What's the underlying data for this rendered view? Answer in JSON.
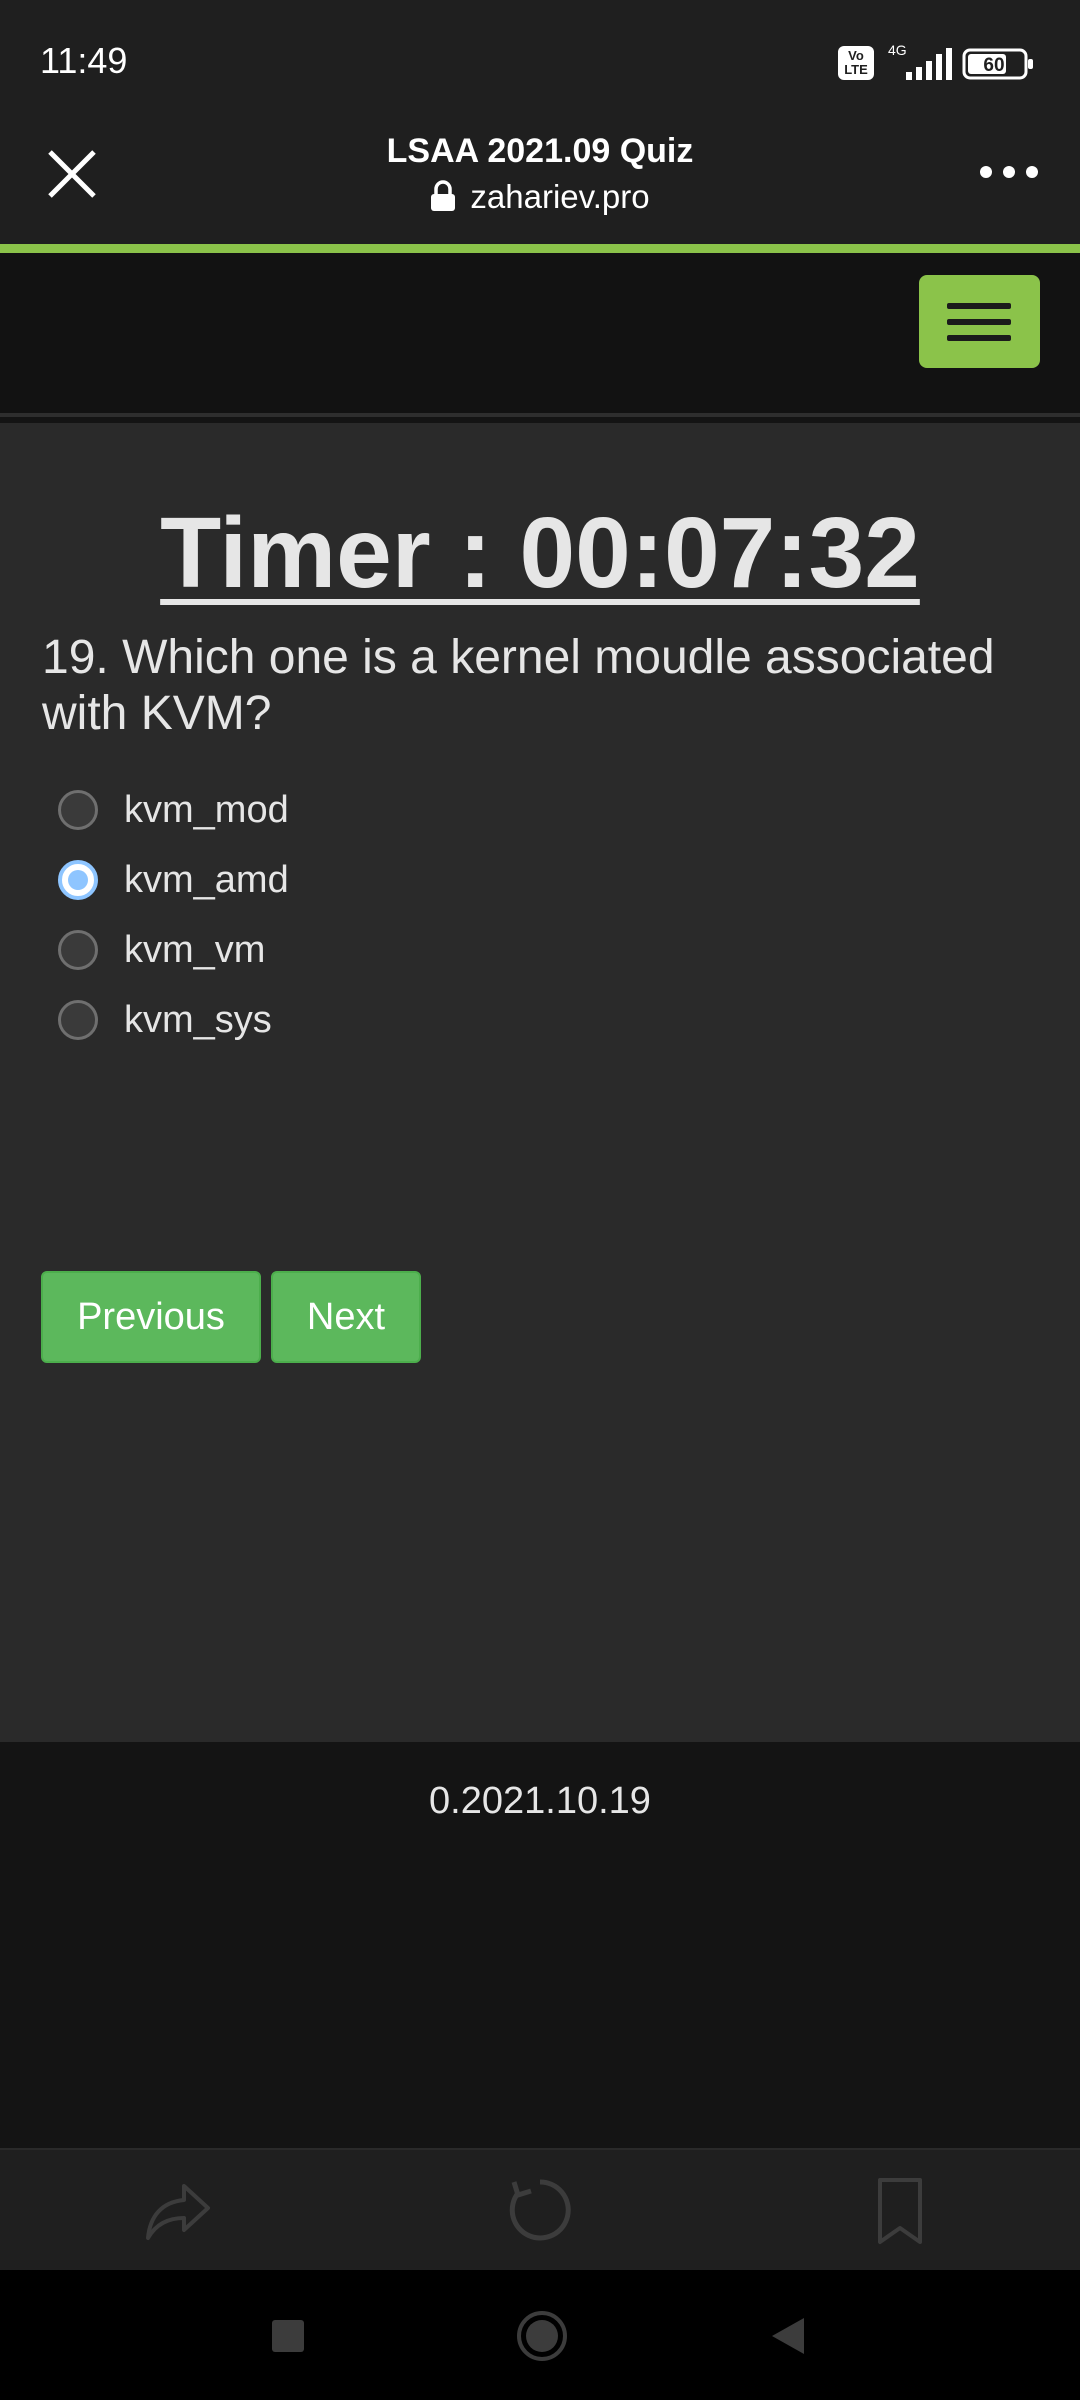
{
  "status_bar": {
    "time": "11:49",
    "volte": "Vo LTE",
    "network": "4G",
    "battery": "60"
  },
  "browser": {
    "title": "LSAA 2021.09 Quiz",
    "url": "zahariev.pro"
  },
  "quiz": {
    "timer": "Timer : 00:07:32",
    "question": "19. Which one is a kernel moudle associated with KVM?",
    "options": [
      {
        "label": "kvm_mod",
        "selected": false
      },
      {
        "label": "kvm_amd",
        "selected": true
      },
      {
        "label": "kvm_vm",
        "selected": false
      },
      {
        "label": "kvm_sys",
        "selected": false
      }
    ],
    "previous_label": "Previous",
    "next_label": "Next"
  },
  "footer": {
    "version": "0.2021.10.19"
  },
  "colors": {
    "accent": "#8bc34a",
    "button": "#5cb85c",
    "radio_selected": "#8ec5ff"
  }
}
